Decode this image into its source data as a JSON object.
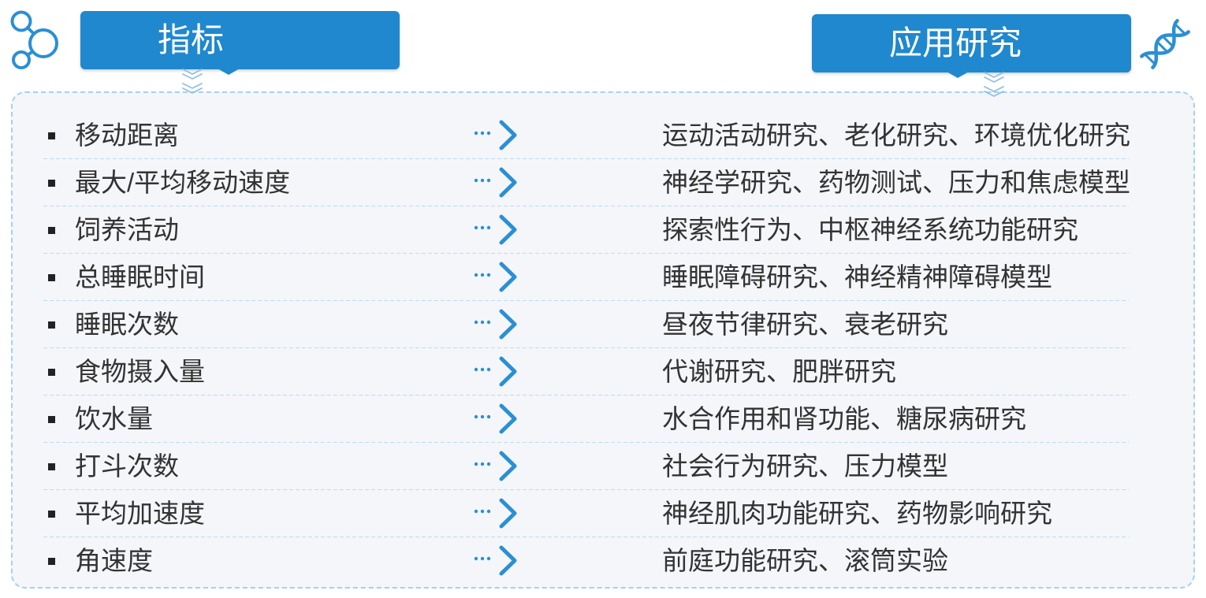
{
  "header": {
    "left_title": "指标",
    "right_title": "应用研究"
  },
  "icons": {
    "header_left": "network-nodes-icon",
    "header_right": "dna-helix-icon",
    "header_pointer": "double-chevron-down-icon",
    "row_bullet": "square-bullet-icon",
    "row_arrow": "dotted-arrow-right-icon"
  },
  "colors": {
    "accent": "#1f88cf",
    "icon": "#2b8fd4",
    "text": "#333333",
    "bullet": "#222222",
    "panel_background": "#f4f6f9",
    "panel_border": "#a6d0ee",
    "row_divider": "#bcdcf2",
    "chevron": "#93bfe2"
  },
  "rows": [
    {
      "metric": "移动距离",
      "application": "运动活动研究、老化研究、环境优化研究"
    },
    {
      "metric": "最大/平均移动速度",
      "application": "神经学研究、药物测试、压力和焦虑模型"
    },
    {
      "metric": "饲养活动",
      "application": "探索性行为、中枢神经系统功能研究"
    },
    {
      "metric": "总睡眠时间",
      "application": "睡眠障碍研究、神经精神障碍模型"
    },
    {
      "metric": "睡眠次数",
      "application": "昼夜节律研究、衰老研究"
    },
    {
      "metric": "食物摄入量",
      "application": "代谢研究、肥胖研究"
    },
    {
      "metric": "饮水量",
      "application": "水合作用和肾功能、糖尿病研究"
    },
    {
      "metric": "打斗次数",
      "application": "社会行为研究、压力模型"
    },
    {
      "metric": "平均加速度",
      "application": "神经肌肉功能研究、药物影响研究"
    },
    {
      "metric": "角速度",
      "application": "前庭功能研究、滚筒实验"
    }
  ]
}
